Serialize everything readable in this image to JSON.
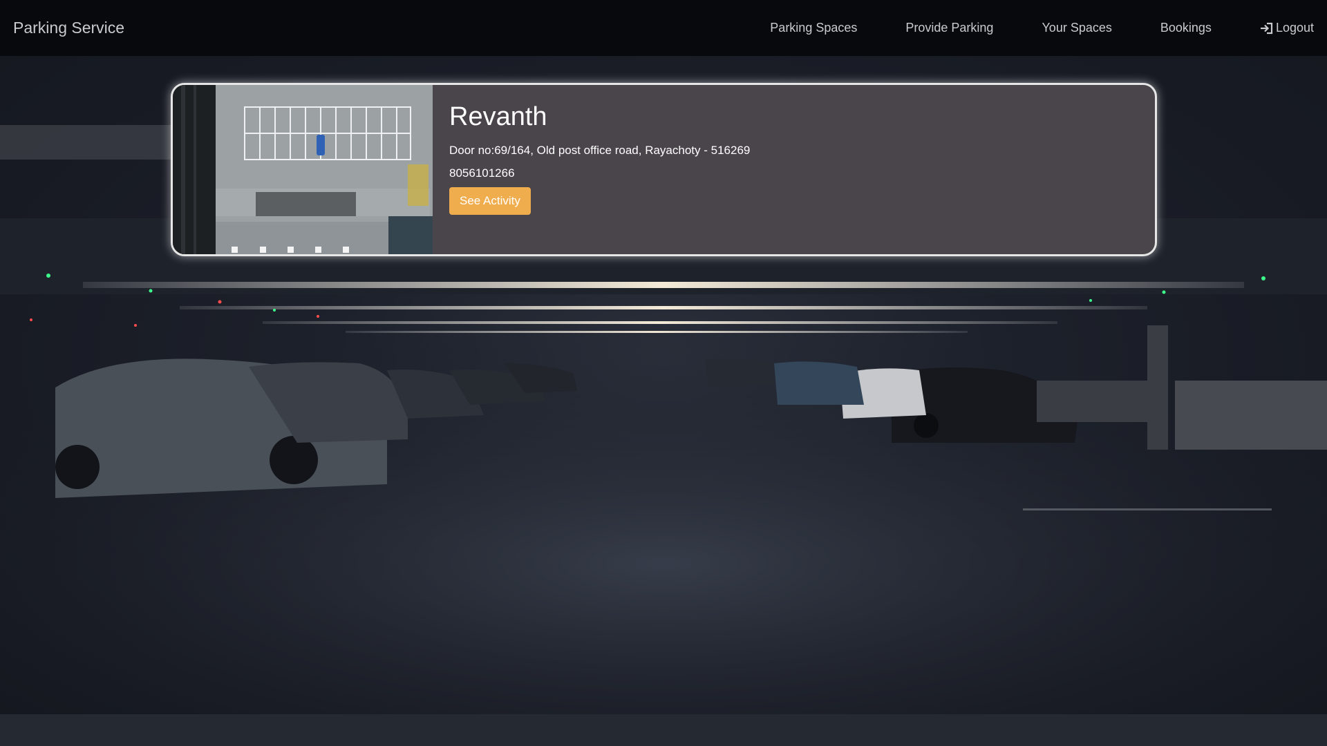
{
  "nav": {
    "brand": "Parking Service",
    "links": [
      {
        "label": "Parking Spaces"
      },
      {
        "label": "Provide Parking"
      },
      {
        "label": "Your Spaces"
      },
      {
        "label": "Bookings"
      },
      {
        "label": "Logout",
        "icon": "login-icon"
      }
    ]
  },
  "card": {
    "name": "Revanth",
    "address": "Door no:69/164, Old post office road, Rayachoty - 516269",
    "phone": "8056101266",
    "button_label": "See Activity",
    "image_icon": "parking-lot-aerial-photo"
  },
  "colors": {
    "navbar": "#07090d",
    "card_bg": "#4a444b",
    "button": "#f0ad4e"
  }
}
